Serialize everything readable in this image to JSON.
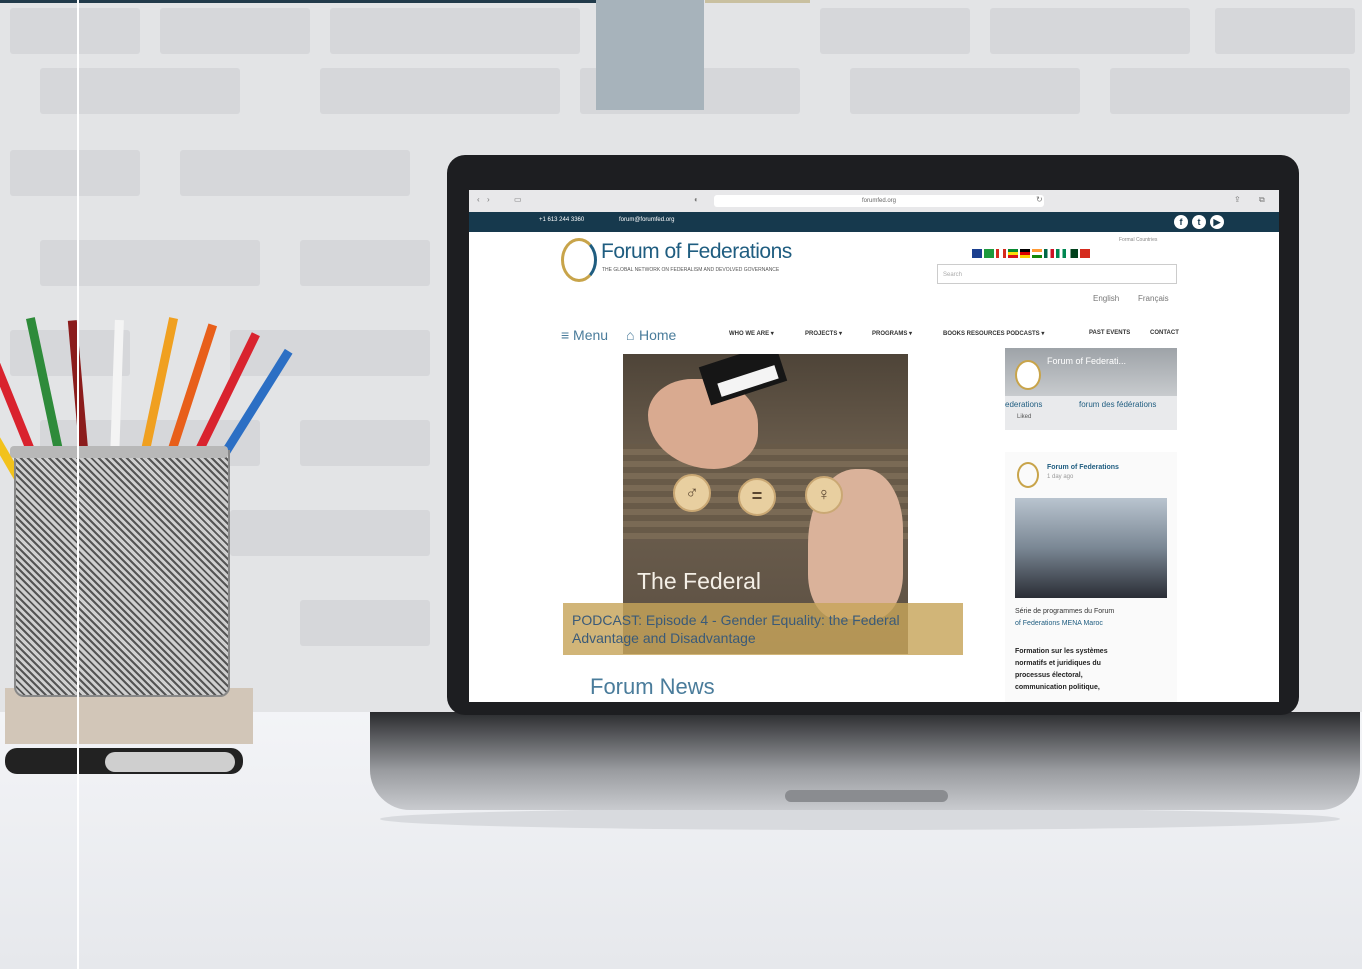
{
  "browser": {
    "url": "forumfed.org"
  },
  "site": {
    "infobar": {
      "phone": "+1 613 244 3360",
      "email": "forum@forumfed.org",
      "social_icons": [
        "facebook-icon",
        "twitter-icon",
        "youtube-icon"
      ]
    },
    "logo": {
      "title": "Forum of Federations",
      "tagline": "THE GLOBAL NETWORK ON FEDERALISM AND DEVOLVED GOVERNANCE"
    },
    "formal_countries_label": "Formal Countries",
    "search_placeholder": "Search",
    "languages": [
      "English",
      "Français"
    ],
    "nav": {
      "menu_label": "≡ Menu",
      "home_label": "Home",
      "items": [
        "WHO WE ARE ▾",
        "PROJECTS ▾",
        "PROGRAMS ▾",
        "BOOKS RESOURCES PODCASTS ▾",
        "PAST EVENTS",
        "CONTACT"
      ]
    },
    "hero": {
      "title": "The Federal",
      "tokens": [
        "♂",
        "=",
        "♀"
      ],
      "podcast_caption": "PODCAST: Episode 4 - Gender Equality: the Federal Advantage and Disadvantage"
    },
    "forum_news_heading": "Forum News",
    "sidebar": {
      "card1_title": "Forum of Federati...",
      "card1_left": "ederations",
      "card1_right": "forum des fédérations",
      "card1_liked": "Liked",
      "card2_author": "Forum of Federations",
      "card2_time": "1 day ago",
      "card2_line1": "Série de programmes du Forum",
      "card2_line2": "of Federations MENA Maroc",
      "card2_bold": [
        "Formation sur les systèmes",
        "normatifs et juridiques du",
        "processus électoral,",
        "communication politique,"
      ]
    },
    "colors": {
      "brand_navy": "#16394d",
      "brand_blue": "#1f5d80",
      "brand_gold": "#c8a44a"
    }
  }
}
